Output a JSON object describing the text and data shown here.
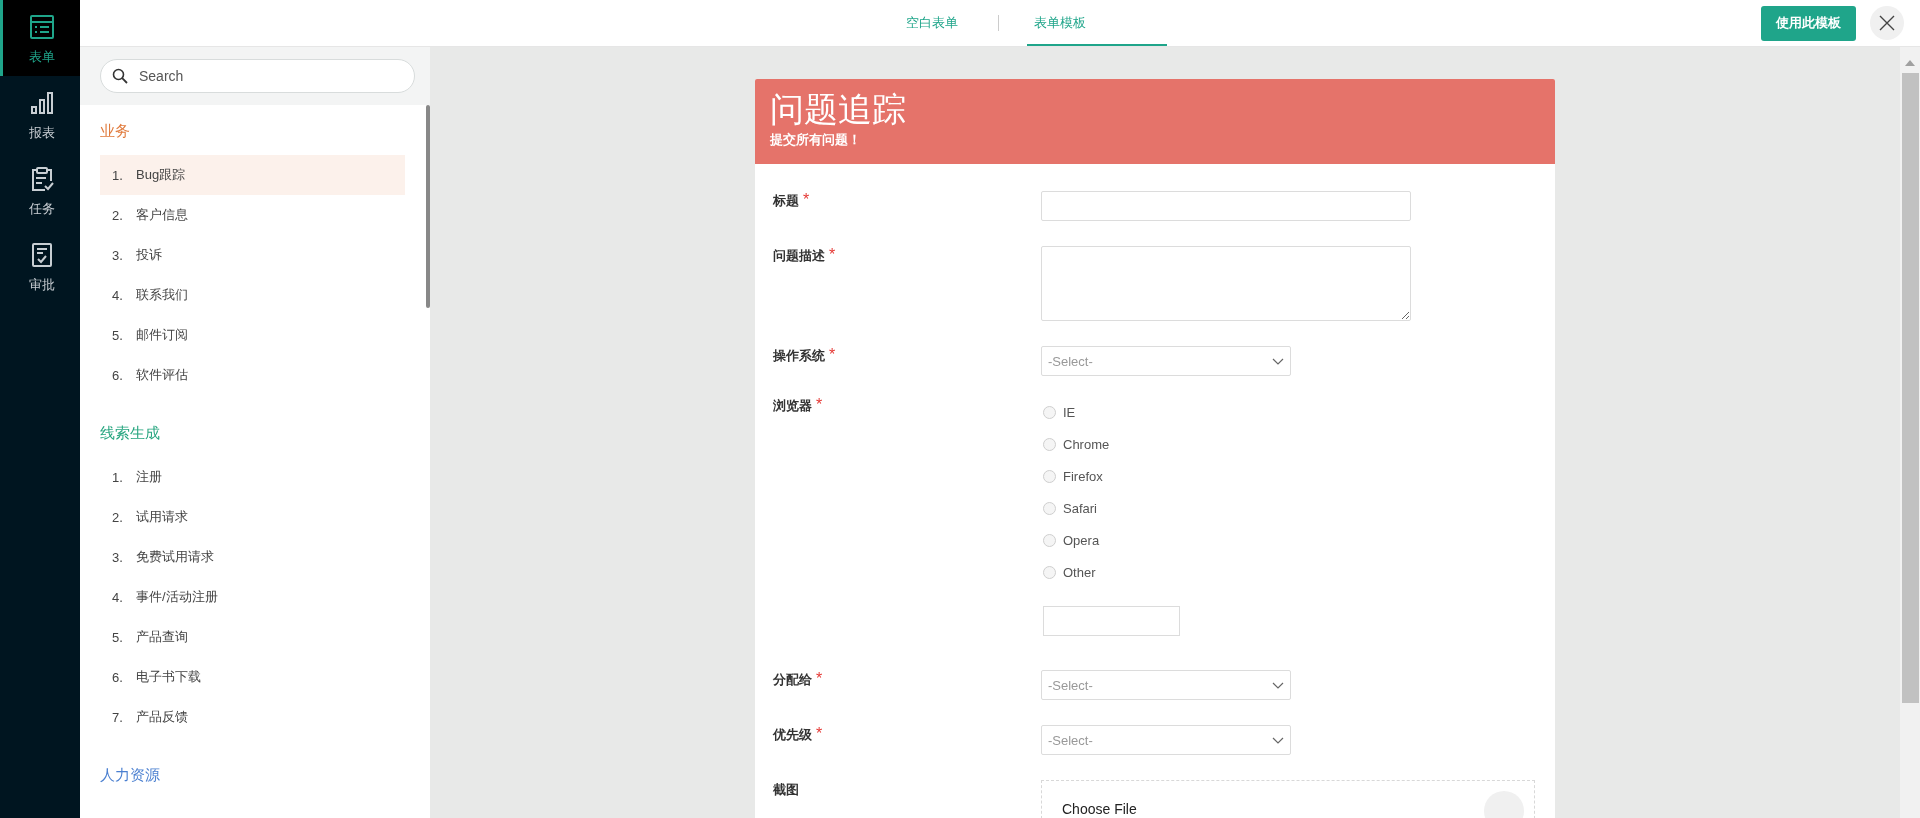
{
  "rail": [
    {
      "label": "表单",
      "kind": "form",
      "selected": true
    },
    {
      "label": "报表",
      "kind": "report",
      "selected": false
    },
    {
      "label": "任务",
      "kind": "task",
      "selected": false
    },
    {
      "label": "审批",
      "kind": "approval",
      "selected": false
    }
  ],
  "tabs": [
    {
      "label": "空白表单",
      "selected": false
    },
    {
      "label": "表单模板",
      "selected": true
    }
  ],
  "use_template_button": "使用此模板",
  "search": {
    "placeholder": "Search"
  },
  "sections": [
    {
      "title": "业务",
      "color": "#e07a3c",
      "items": [
        {
          "number": "1.",
          "label": "Bug跟踪",
          "selected": true
        },
        {
          "number": "2.",
          "label": "客户信息",
          "selected": false
        },
        {
          "number": "3.",
          "label": "投诉",
          "selected": false
        },
        {
          "number": "4.",
          "label": "联系我们",
          "selected": false
        },
        {
          "number": "5.",
          "label": "邮件订阅",
          "selected": false
        },
        {
          "number": "6.",
          "label": "软件评估",
          "selected": false
        }
      ]
    },
    {
      "title": "线索生成",
      "color": "#26a57f",
      "items": [
        {
          "number": "1.",
          "label": "注册",
          "selected": false
        },
        {
          "number": "2.",
          "label": "试用请求",
          "selected": false
        },
        {
          "number": "3.",
          "label": "免费试用请求",
          "selected": false
        },
        {
          "number": "4.",
          "label": "事件/活动注册",
          "selected": false
        },
        {
          "number": "5.",
          "label": "产品查询",
          "selected": false
        },
        {
          "number": "6.",
          "label": "电子书下载",
          "selected": false
        },
        {
          "number": "7.",
          "label": "产品反馈",
          "selected": false
        }
      ]
    },
    {
      "title": "人力资源",
      "color": "#4a7fd0"
    }
  ],
  "form": {
    "title": "问题追踪",
    "subtitle": "提交所有问题！",
    "fields": [
      {
        "kind": "text",
        "label": "标题",
        "required_mark": "*"
      },
      {
        "kind": "textarea",
        "label": "问题描述",
        "required_mark": "*"
      },
      {
        "kind": "select",
        "label": "操作系统",
        "required_mark": "*",
        "placeholder": "-Select-"
      },
      {
        "kind": "radio",
        "label": "浏览器",
        "required_mark": "*",
        "options": [
          {
            "label": "IE",
            "selected": false
          },
          {
            "label": "Chrome",
            "selected": false
          },
          {
            "label": "Firefox",
            "selected": false
          },
          {
            "label": "Safari",
            "selected": false
          },
          {
            "label": "Opera",
            "selected": false
          },
          {
            "label": "Other",
            "selected": false
          }
        ]
      },
      {
        "kind": "select",
        "label": "分配给",
        "required_mark": "*",
        "placeholder": "-Select-"
      },
      {
        "kind": "select",
        "label": "优先级",
        "required_mark": "*",
        "placeholder": "-Select-"
      },
      {
        "kind": "file",
        "label": "截图",
        "button": "Choose File"
      }
    ]
  }
}
